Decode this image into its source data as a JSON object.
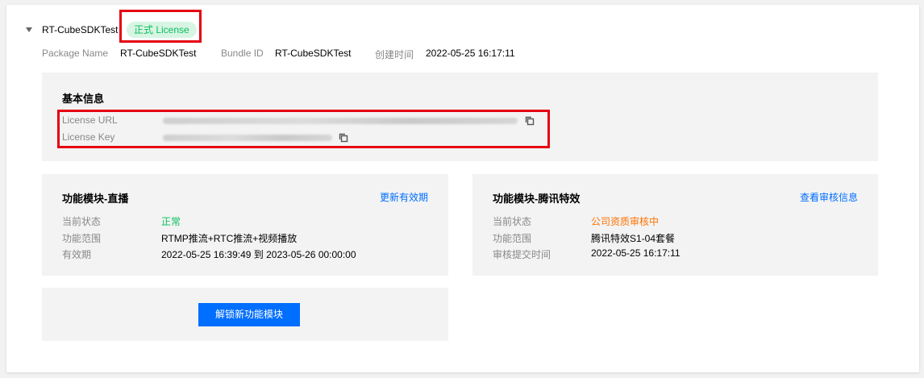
{
  "app": {
    "title": "RT-CubeSDKTest",
    "badge": "正式 License"
  },
  "meta": {
    "package_label": "Package Name",
    "package_value": "RT-CubeSDKTest",
    "bundle_label": "Bundle ID",
    "bundle_value": "RT-CubeSDKTest",
    "created_label": "创建时间",
    "created_value": "2022-05-25 16:17:11"
  },
  "basic": {
    "title": "基本信息",
    "url_label": "License URL",
    "key_label": "License Key",
    "copy_icon": "copy-icon"
  },
  "live": {
    "title": "功能模块-直播",
    "action": "更新有效期",
    "status_label": "当前状态",
    "status_value": "正常",
    "scope_label": "功能范围",
    "scope_value": "RTMP推流+RTC推流+视频播放",
    "validity_label": "有效期",
    "validity_value": "2022-05-25 16:39:49 到 2023-05-26 00:00:00"
  },
  "effects": {
    "title": "功能模块-腾讯特效",
    "action": "查看审核信息",
    "status_label": "当前状态",
    "status_value": "公司资质审核中",
    "scope_label": "功能范围",
    "scope_value": "腾讯特效S1-04套餐",
    "submit_label": "审核提交时间",
    "submit_value": "2022-05-25 16:17:11"
  },
  "unlock": {
    "button_label": "解锁新功能模块"
  },
  "colors": {
    "accent": "#006eff",
    "success": "#0abf5b",
    "warning": "#ff7200",
    "highlight": "#e60012"
  }
}
